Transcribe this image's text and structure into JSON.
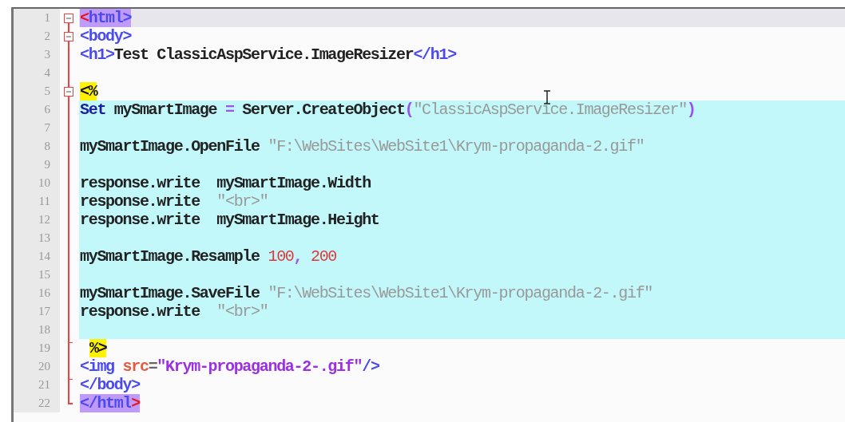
{
  "editor": {
    "lines": [
      {
        "number": "1",
        "kind": "open",
        "current": true,
        "embedded": false,
        "tokens": [
          {
            "kind": "matched-tag-start",
            "text": "<"
          },
          {
            "kind": "matched-tag",
            "text": "html>"
          }
        ]
      },
      {
        "number": "2",
        "kind": "open",
        "current": false,
        "embedded": false,
        "tokens": [
          {
            "kind": "tag",
            "text": "<body>"
          }
        ]
      },
      {
        "number": "3",
        "kind": "line",
        "current": false,
        "embedded": false,
        "tokens": [
          {
            "kind": "tag",
            "text": "<h1>"
          },
          {
            "kind": "text",
            "text": "Test ClassicAspService.ImageResizer"
          },
          {
            "kind": "tag",
            "text": "</h1>"
          }
        ]
      },
      {
        "number": "4",
        "kind": "line",
        "current": false,
        "embedded": false
      },
      {
        "number": "5",
        "kind": "open",
        "current": false,
        "embedded": false,
        "tokens": [
          {
            "kind": "asp",
            "text": "<%"
          }
        ]
      },
      {
        "number": "6",
        "kind": "line",
        "current": false,
        "embedded": true,
        "tokens": [
          {
            "kind": "keyword",
            "text": "Set"
          },
          {
            "kind": "text",
            "text": " mySmartImage "
          },
          {
            "kind": "op",
            "text": "="
          },
          {
            "kind": "text",
            "text": " Server.CreateObject"
          },
          {
            "kind": "op",
            "text": "("
          },
          {
            "kind": "string",
            "text": "\"ClassicAspService.ImageResizer\""
          },
          {
            "kind": "op",
            "text": ")"
          }
        ]
      },
      {
        "number": "7",
        "kind": "line",
        "current": false,
        "embedded": true
      },
      {
        "number": "8",
        "kind": "line",
        "current": false,
        "embedded": true,
        "tokens": [
          {
            "kind": "text",
            "text": "mySmartImage.OpenFile "
          },
          {
            "kind": "string",
            "text": "\"F:\\WebSites\\WebSite1\\Krym-propaganda-2.gif\""
          }
        ]
      },
      {
        "number": "9",
        "kind": "line",
        "current": false,
        "embedded": true
      },
      {
        "number": "10",
        "kind": "line",
        "current": false,
        "embedded": true,
        "tokens": [
          {
            "kind": "text",
            "text": "response.write  mySmartImage.Width"
          }
        ]
      },
      {
        "number": "11",
        "kind": "line",
        "current": false,
        "embedded": true,
        "tokens": [
          {
            "kind": "text",
            "text": "response.write  "
          },
          {
            "kind": "string",
            "text": "\"<br>\""
          }
        ]
      },
      {
        "number": "12",
        "kind": "line",
        "current": false,
        "embedded": true,
        "tokens": [
          {
            "kind": "text",
            "text": "response.write  mySmartImage.Height"
          }
        ]
      },
      {
        "number": "13",
        "kind": "line",
        "current": false,
        "embedded": true
      },
      {
        "number": "14",
        "kind": "line",
        "current": false,
        "embedded": true,
        "tokens": [
          {
            "kind": "text",
            "text": "mySmartImage.Resample "
          },
          {
            "kind": "number",
            "text": "100"
          },
          {
            "kind": "op",
            "text": ","
          },
          {
            "kind": "number",
            "text": " 200"
          }
        ]
      },
      {
        "number": "15",
        "kind": "line",
        "current": false,
        "embedded": true
      },
      {
        "number": "16",
        "kind": "line",
        "current": false,
        "embedded": true,
        "tokens": [
          {
            "kind": "text",
            "text": "mySmartImage.SaveFile "
          },
          {
            "kind": "string",
            "text": "\"F:\\WebSites\\WebSite1\\Krym-propaganda-2-.gif\""
          }
        ]
      },
      {
        "number": "17",
        "kind": "line",
        "current": false,
        "embedded": true,
        "tokens": [
          {
            "kind": "text",
            "text": "response.write  "
          },
          {
            "kind": "string",
            "text": "\"<br>\""
          }
        ]
      },
      {
        "number": "18",
        "kind": "line",
        "current": false,
        "embedded": true
      },
      {
        "number": "19",
        "kind": "end",
        "current": false,
        "embedded": false,
        "indented": true,
        "tokens": [
          {
            "kind": "asp",
            "text": "%>"
          }
        ]
      },
      {
        "number": "20",
        "kind": "line",
        "current": false,
        "embedded": false,
        "tokens": [
          {
            "kind": "tag",
            "text": "<img "
          },
          {
            "kind": "attr",
            "text": "src"
          },
          {
            "kind": "plain",
            "text": "="
          },
          {
            "kind": "value",
            "text": "\"Krym-propaganda-2-.gif\""
          },
          {
            "kind": "tag",
            "text": "/>"
          }
        ]
      },
      {
        "number": "21",
        "kind": "end",
        "current": false,
        "embedded": false,
        "tokens": [
          {
            "kind": "tag",
            "text": "</body>"
          }
        ]
      },
      {
        "number": "22",
        "kind": "last",
        "current": false,
        "embedded": false,
        "tokens": [
          {
            "kind": "matched-tag",
            "text": "</html"
          },
          {
            "kind": "matched-tag-start",
            "text": ">"
          }
        ]
      }
    ]
  }
}
